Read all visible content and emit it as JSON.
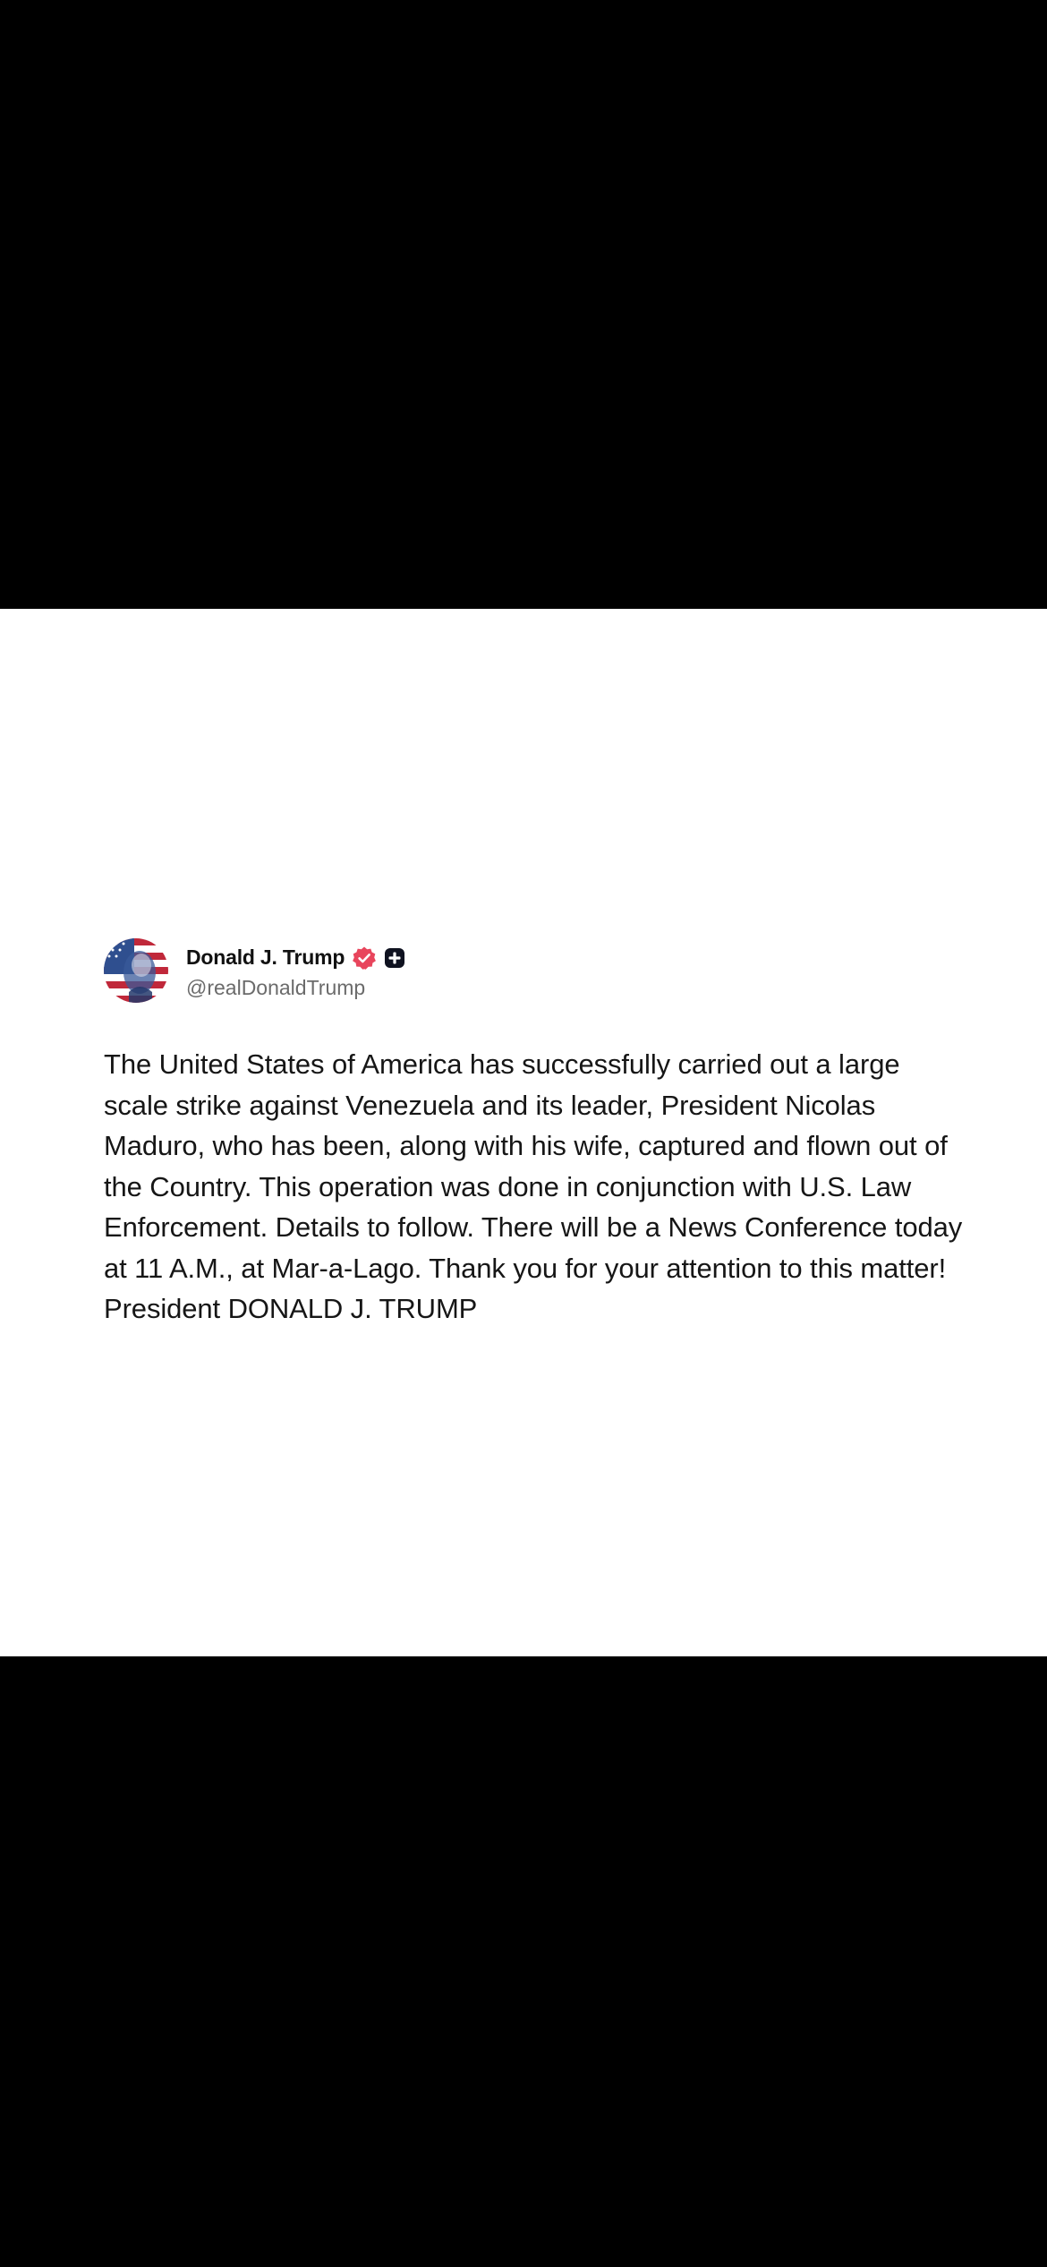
{
  "post": {
    "author": {
      "display_name": "Donald J. Trump",
      "handle": "@realDonaldTrump",
      "verified_icon": "verified-badge-icon",
      "plus_icon": "plus-badge-icon",
      "avatar": "profile-avatar"
    },
    "text": "The United States of America has successfully carried out a large scale strike against Venezuela and its leader, President Nicolas Maduro, who has been, along with his wife, captured and flown out of the Country. This operation was done in conjunction with U.S. Law Enforcement. Details to follow. There will be a News Conference today at 11 A.M., at Mar-a-Lago. Thank you for your attention to this matter! President DONALD J. TRUMP"
  },
  "colors": {
    "background_outer": "#000000",
    "card": "#ffffff",
    "verified": "#e8455c",
    "text": "#161616",
    "handle": "#6b6b6b"
  }
}
